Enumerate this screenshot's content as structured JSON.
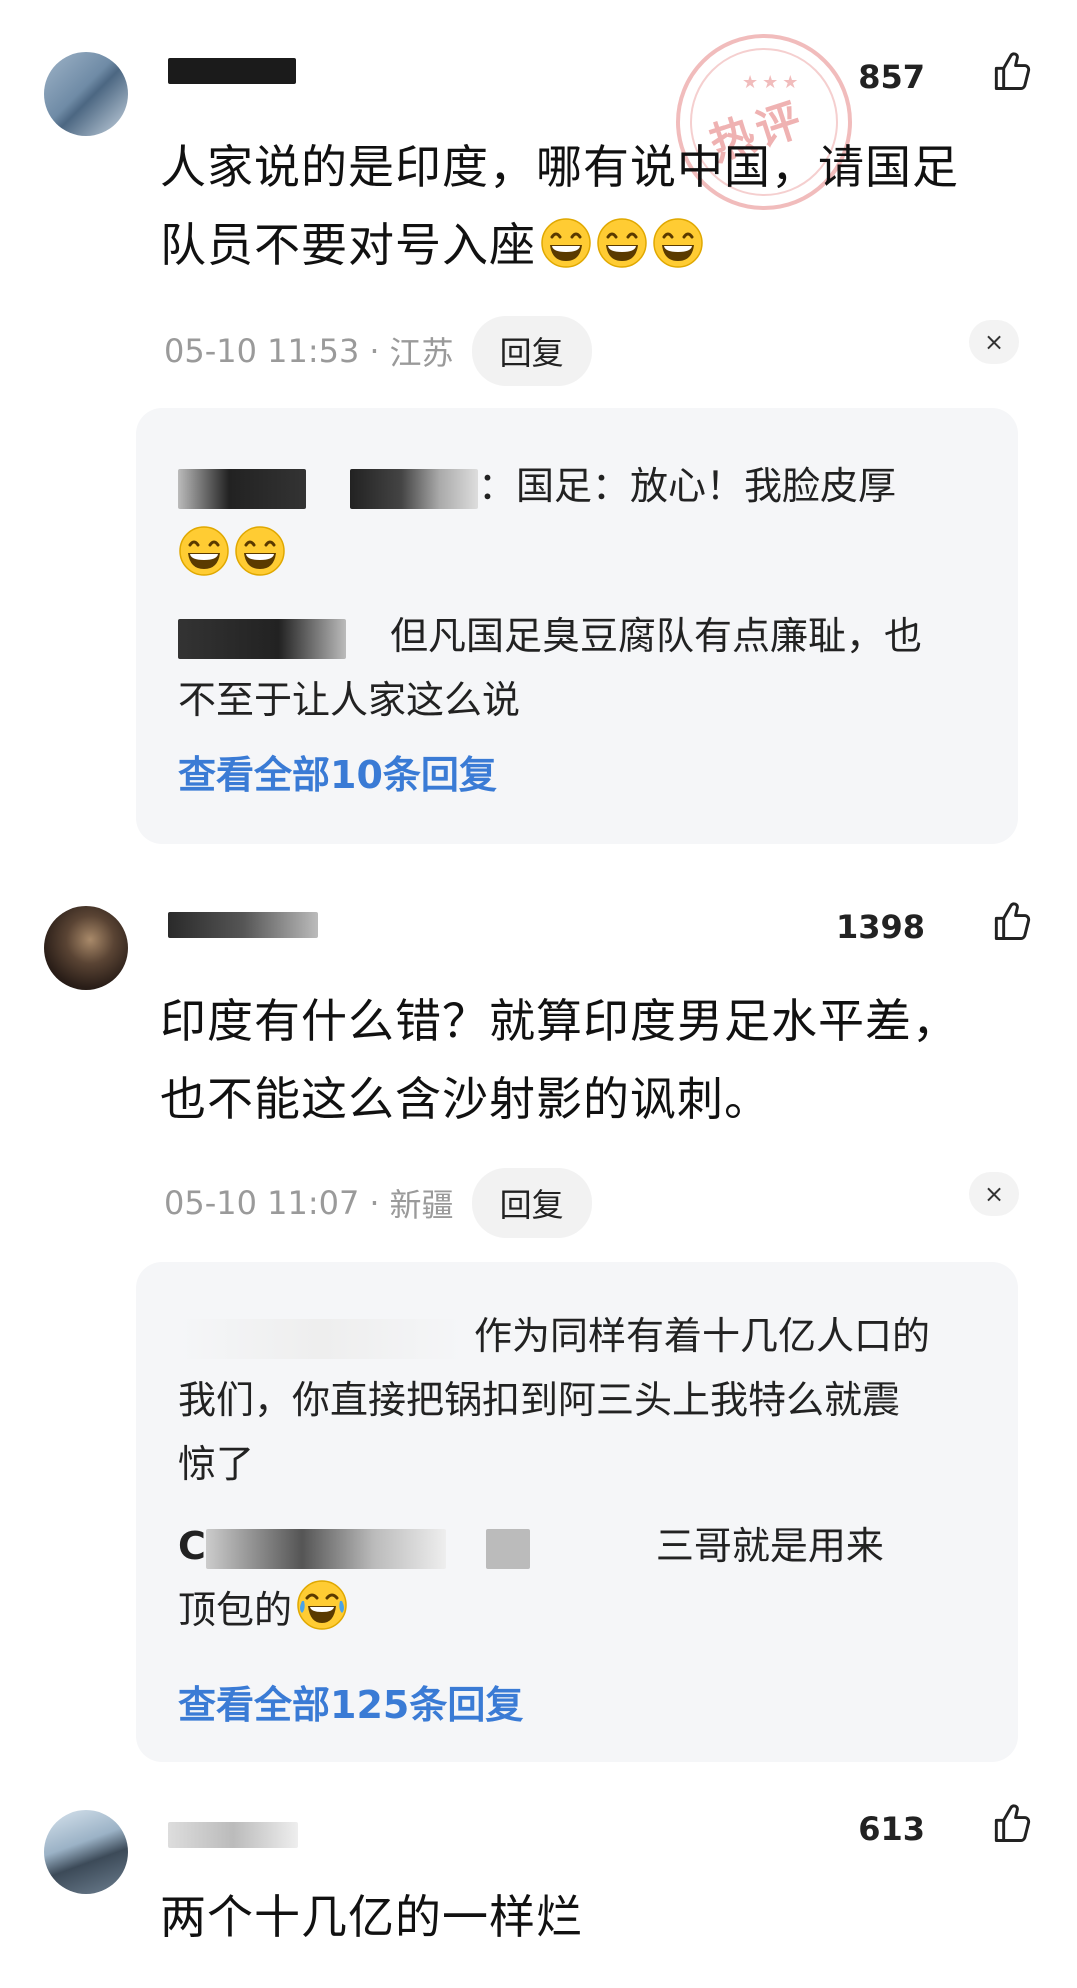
{
  "comments": [
    {
      "likes": "857",
      "hot_badge": "热评",
      "hot_badge_stars": "★★★",
      "text_line1": "人家说的是印度，哪有说中国，请国足",
      "text_line2": "队员不要对号入座",
      "text_emojis": [
        "grinning-face",
        "grinning-face",
        "grinning-face"
      ],
      "timestamp": "05-10 11:53",
      "separator": "·",
      "location": "江苏",
      "reply_label": "回复",
      "close_icon": "×",
      "replies": [
        {
          "text_line1": "：国足：放心！我脸皮厚",
          "text_emojis": [
            "grinning-face",
            "grinning-face"
          ]
        },
        {
          "text_line1": "但凡国足臭豆腐队有点廉耻，也",
          "text_line2": "不至于让人家这么说"
        }
      ],
      "see_all": "查看全部10条回复"
    },
    {
      "likes": "1398",
      "text_line1": "印度有什么错？就算印度男足水平差，",
      "text_line2": "也不能这么含沙射影的讽刺。",
      "timestamp": "05-10 11:07",
      "separator": "·",
      "location": "新疆",
      "reply_label": "回复",
      "close_icon": "×",
      "replies": [
        {
          "text_line1": "作为同样有着十几亿人口的",
          "text_line2": "我们，你直接把锅扣到阿三头上我特么就震",
          "text_line3": "惊了"
        },
        {
          "prefix": "C",
          "text_line1": "三哥就是用来",
          "text_line2": "顶包的",
          "text_emojis": [
            "tears-of-joy-face"
          ]
        }
      ],
      "see_all": "查看全部125条回复"
    },
    {
      "likes": "613",
      "text_line1": "两个十几亿的一样烂"
    }
  ],
  "colors": {
    "link_blue": "#3a7bd5",
    "meta_gray": "#9a9a9a",
    "reply_bg": "#f5f6f8",
    "stamp_red": "#d63e3e"
  },
  "icons": {
    "like": "thumbs-up-icon",
    "close": "close-icon",
    "emoji_grin": "grinning-face",
    "emoji_laugh": "tears-of-joy-face"
  }
}
